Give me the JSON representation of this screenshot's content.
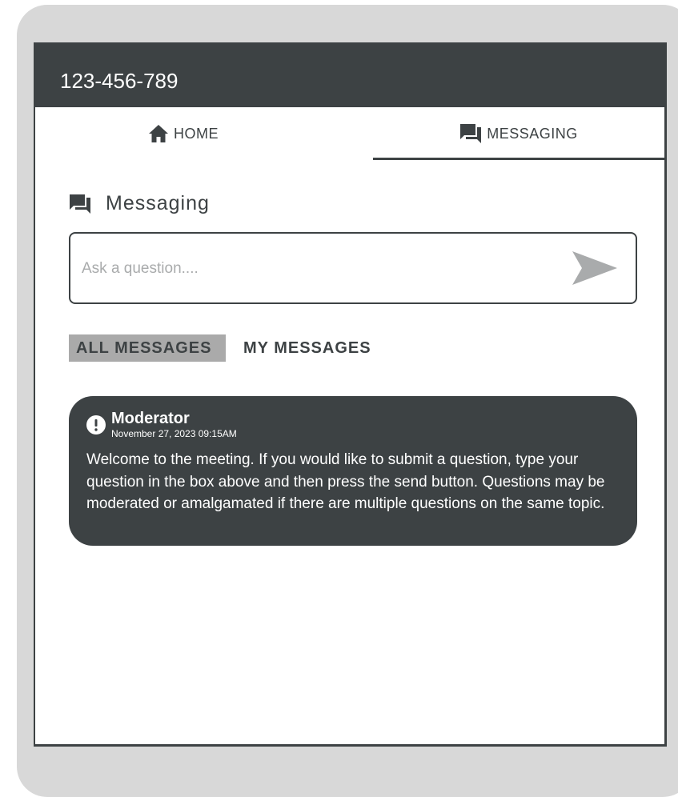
{
  "header": {
    "phone_number": "123-456-789"
  },
  "tabs": [
    {
      "label": "HOME",
      "icon": "home-icon",
      "active": false
    },
    {
      "label": "MESSAGING",
      "icon": "chat-bubbles-icon",
      "active": true
    }
  ],
  "messaging": {
    "title": "Messaging",
    "title_icon": "chat-bubbles-icon",
    "input": {
      "placeholder": "Ask a question....",
      "value": ""
    },
    "send_icon": "send-arrow-icon",
    "filters": [
      {
        "label": "ALL MESSAGES",
        "active": true
      },
      {
        "label": "MY MESSAGES",
        "active": false
      }
    ],
    "messages": [
      {
        "author": "Moderator",
        "timestamp": "November 27, 2023 09:15AM",
        "icon": "exclamation-icon",
        "body": "Welcome to the meeting. If you would like to submit a question, type your question in the box above and then press the send button. Questions may be moderated or amalgamated if there are multiple questions on the same topic."
      }
    ]
  },
  "colors": {
    "frame": "#d8d8d8",
    "dark": "#3d4244",
    "active_filter": "#aaaaaa",
    "placeholder": "#a9abac",
    "send_icon": "#a9abac"
  }
}
